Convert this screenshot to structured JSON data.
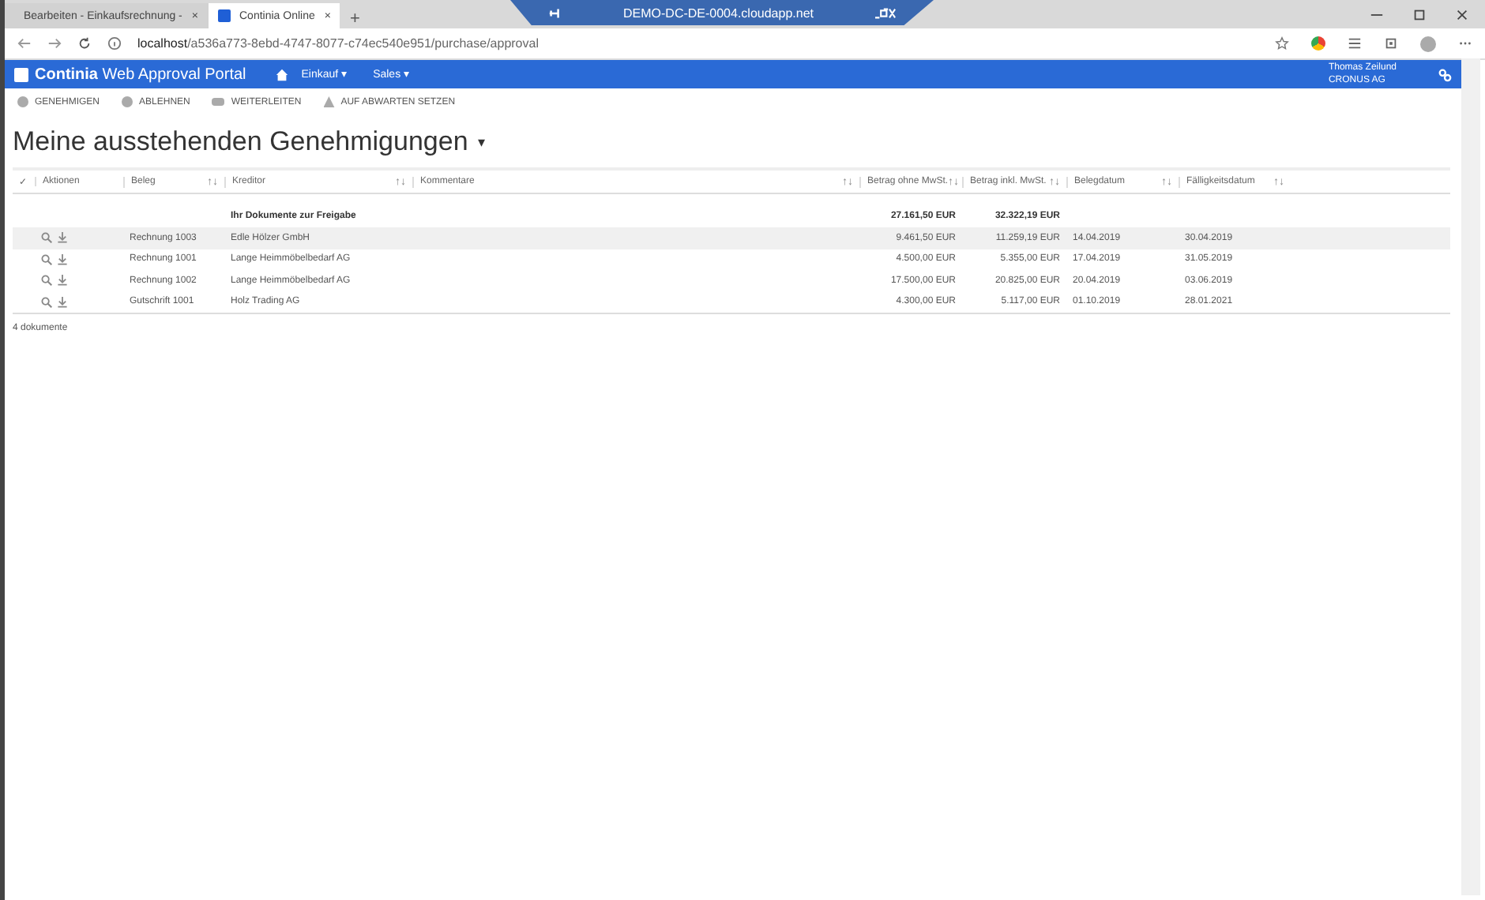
{
  "browser": {
    "tabs": [
      {
        "title": "Bearbeiten - Einkaufsrechnung -",
        "close": "×",
        "selected": false
      },
      {
        "title": "Continia Online",
        "close": "×",
        "selected": true
      }
    ],
    "new_tab": "+",
    "remote_bar": {
      "title": "DEMO-DC-DE-0004.cloudapp.net"
    },
    "url_host": "localhost",
    "url_path": "/a536a773-8ebd-4747-8077-c74ec540e951/purchase/approval"
  },
  "header": {
    "brand_bold": "Continia",
    "brand_rest": "Web Approval Portal",
    "menus": [
      {
        "label": "Einkauf",
        "caret": "▾"
      },
      {
        "label": "Sales",
        "caret": "▾"
      }
    ],
    "user": "Thomas Zeilund",
    "company": "CRONUS AG"
  },
  "toolbar": [
    {
      "kind": "approve",
      "label": "GENEHMIGEN"
    },
    {
      "kind": "reject",
      "label": "ABLEHNEN"
    },
    {
      "kind": "forward",
      "label": "WEITERLEITEN"
    },
    {
      "kind": "hold",
      "label": "AUF ABWARTEN SETZEN"
    }
  ],
  "page_title": "Meine ausstehenden Genehmigungen",
  "title_caret": "▾",
  "table": {
    "check": "✓",
    "columns": [
      {
        "label": "Aktionen",
        "sortable": false
      },
      {
        "label": "Beleg",
        "sortable": true
      },
      {
        "label": "Kreditor",
        "sortable": true
      },
      {
        "label": "Kommentare",
        "sortable": true
      },
      {
        "label": "Betrag ohne MwSt.",
        "sortable": true
      },
      {
        "label": "Betrag inkl. MwSt.",
        "sortable": true
      },
      {
        "label": "Belegdatum",
        "sortable": true
      },
      {
        "label": "Fälligkeitsdatum",
        "sortable": true
      }
    ],
    "sort_glyph": "↑↓",
    "group": {
      "label": "Ihr Dokumente zur Freigabe",
      "total_net": "27.161,50 EUR",
      "total_gross": "32.322,19 EUR"
    },
    "rows": [
      {
        "beleg": "Rechnung 1003",
        "kreditor": "Edle Hölzer GmbH",
        "net": "9.461,50 EUR",
        "gross": "11.259,19 EUR",
        "date": "14.04.2019",
        "due": "30.04.2019",
        "highlighted": true
      },
      {
        "beleg": "Rechnung 1001",
        "kreditor": "Lange Heimmöbelbedarf AG",
        "net": "4.500,00 EUR",
        "gross": "5.355,00 EUR",
        "date": "17.04.2019",
        "due": "31.05.2019",
        "highlighted": false
      },
      {
        "beleg": "Rechnung 1002",
        "kreditor": "Lange Heimmöbelbedarf AG",
        "net": "17.500,00 EUR",
        "gross": "20.825,00 EUR",
        "date": "20.04.2019",
        "due": "03.06.2019",
        "highlighted": false
      },
      {
        "beleg": "Gutschrift 1001",
        "kreditor": "Holz Trading AG",
        "net": "4.300,00 EUR",
        "gross": "5.117,00 EUR",
        "date": "01.10.2019",
        "due": "28.01.2021",
        "highlighted": false
      }
    ],
    "footer": "4 dokumente"
  }
}
